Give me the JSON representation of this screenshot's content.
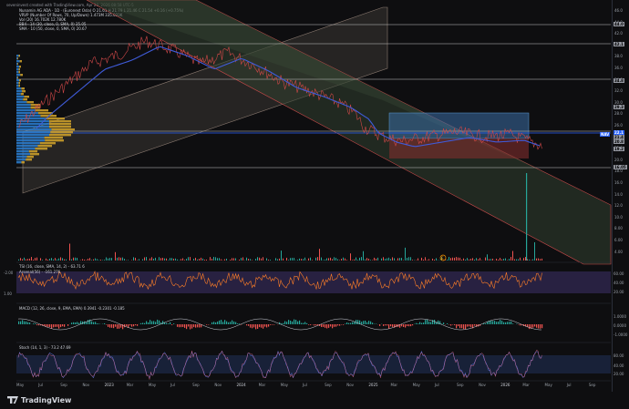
{
  "header": {
    "created_by": "seveninvest created with TradingView.com, Apr 20, 2026 08:58 UTC-5",
    "legend": [
      "Nunamin AG ADA · 1D · (Euronext Osla) O 21.61 H 21.79 L 21.46 C 21.54 +0.16 (+0.75%)",
      "VRVP (Number Of Rows, 70, Up/Down) 1.473M 335.033K",
      "Vol (20) 16.702K 12.780K",
      "BB4 · 14 (30, close, 0, SMA, 0) 25.05",
      "SMA · 10 (50, close, 0, SMA, 0) 20.67"
    ]
  },
  "price_axis": {
    "ticks": [
      "46.0",
      "44.0",
      "42.0",
      "40.0",
      "38.0",
      "36.0",
      "34.0",
      "32.0",
      "30.0",
      "28.0",
      "26.0",
      "24.0",
      "22.0",
      "20.0",
      "18.0",
      "16.0",
      "14.0",
      "12.0",
      "10.0",
      "8.00",
      "6.00",
      "4.00"
    ],
    "tags": [
      {
        "label": "44.0",
        "color": "#9598a1"
      },
      {
        "label": "42.1",
        "color": "#9598a1"
      },
      {
        "label": "34.8",
        "color": "#9598a1"
      },
      {
        "label": "29.3",
        "color": "#9598a1"
      },
      {
        "label": "22.1",
        "color": "#2962ff"
      },
      {
        "label": "21.4",
        "color": "#9598a1"
      },
      {
        "label": "20.8",
        "color": "#9598a1"
      },
      {
        "label": "19.2",
        "color": "#9598a1"
      },
      {
        "label": "16.05",
        "color": "#9598a1"
      }
    ],
    "nav_tag": "NAV"
  },
  "tsi_pane": {
    "legend_1": "TSI (16, close, SMA, 14, 2)  -  63.71  6",
    "legend_2": "Arsenal(56)  -  -161.276",
    "ticks": [
      "60.00",
      "40.00",
      "20.00"
    ],
    "side_labels": [
      "-2.00",
      "1.00"
    ]
  },
  "macd_pane": {
    "legend": "MACD (12, 26, close, 9, EMA, EMA)  0.3941  -0.2301  -0.185",
    "ticks": [
      "1.0000",
      "0.0000",
      "-1.0000"
    ]
  },
  "stoch_pane": {
    "legend": "Stoch (14, 1, 3)  -  73.2  47.69",
    "ticks": [
      "80.00",
      "40.00",
      "20.00"
    ]
  },
  "time_axis": {
    "labels": [
      "May",
      "Jul",
      "Sep",
      "Nov",
      "2023",
      "Mar",
      "May",
      "Jul",
      "Sep",
      "Nov",
      "2024",
      "Mar",
      "May",
      "Jul",
      "Sep",
      "Nov",
      "2025",
      "Mar",
      "May",
      "Jul",
      "Sep",
      "Nov",
      "2026",
      "Mar",
      "May",
      "Jul",
      "Sep"
    ]
  },
  "event_badge": "E",
  "footer": {
    "logo_text": "TradingView"
  },
  "colors": {
    "background": "#0e0e10",
    "sma_line": "#3f5bd9",
    "candle_up": "#26a69a",
    "candle_down": "#ef5350",
    "tsi_line": "#ff7f27",
    "channel_fill": "#2b3a2b",
    "upper_channel_fill": "#3d3530"
  }
}
